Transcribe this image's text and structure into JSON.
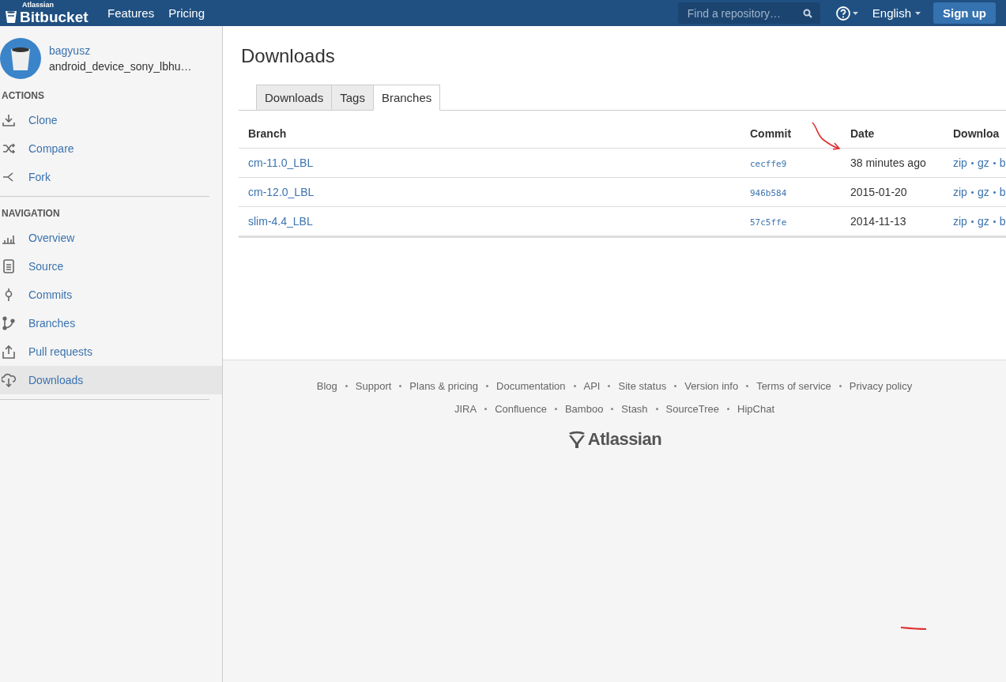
{
  "header": {
    "brand_small": "Atlassian",
    "brand": "Bitbucket",
    "nav": [
      "Features",
      "Pricing"
    ],
    "search": {
      "placeholder": "Find a repository…"
    },
    "language": "English",
    "signup": "Sign up"
  },
  "sidebar": {
    "owner": "bagyusz",
    "repo": "android_device_sony_lbhu…",
    "sections": [
      {
        "title": "ACTIONS",
        "items": [
          {
            "label": "Clone",
            "selected": false
          },
          {
            "label": "Compare",
            "selected": false
          },
          {
            "label": "Fork",
            "selected": false
          }
        ]
      },
      {
        "title": "NAVIGATION",
        "items": [
          {
            "label": "Overview",
            "selected": false
          },
          {
            "label": "Source",
            "selected": false
          },
          {
            "label": "Commits",
            "selected": false
          },
          {
            "label": "Branches",
            "selected": false
          },
          {
            "label": "Pull requests",
            "selected": false
          },
          {
            "label": "Downloads",
            "selected": true
          }
        ]
      }
    ]
  },
  "page": {
    "title": "Downloads",
    "tabs": [
      {
        "label": "Downloads",
        "selected": false
      },
      {
        "label": "Tags",
        "selected": false
      },
      {
        "label": "Branches",
        "selected": true
      }
    ]
  },
  "table": {
    "columns": [
      "Branch",
      "Commit",
      "Date",
      "Downloa"
    ],
    "rows": [
      {
        "branch": "cm-11.0_LBL",
        "commit": "cecffe9",
        "date": "38 minutes ago",
        "downloads": [
          "zip",
          "gz",
          "b"
        ]
      },
      {
        "branch": "cm-12.0_LBL",
        "commit": "946b584",
        "date": "2015-01-20",
        "downloads": [
          "zip",
          "gz",
          "b"
        ]
      },
      {
        "branch": "slim-4.4_LBL",
        "commit": "57c5ffe",
        "date": "2014-11-13",
        "downloads": [
          "zip",
          "gz",
          "b"
        ]
      }
    ]
  },
  "footer": {
    "links": [
      [
        "Blog",
        "Support",
        "Plans & pricing",
        "Documentation",
        "API",
        "Site status",
        "Version info",
        "Terms of service",
        "Privacy policy"
      ],
      [
        "JIRA",
        "Confluence",
        "Bamboo",
        "Stash",
        "SourceTree",
        "HipChat"
      ]
    ],
    "logo": "Atlassian"
  }
}
